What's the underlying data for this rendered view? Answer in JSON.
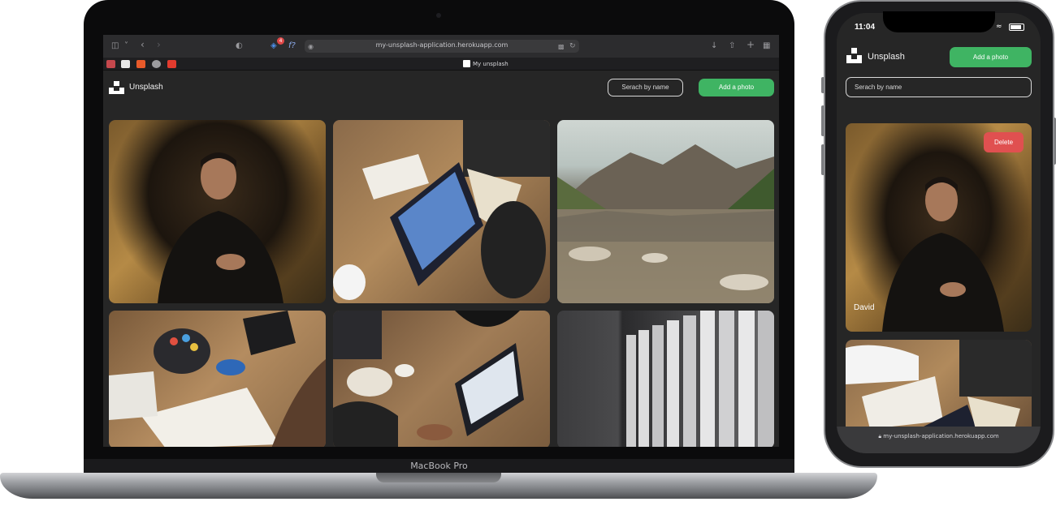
{
  "browser": {
    "url": "my-unsplash-application.herokuapp.com",
    "tab_title": "My unsplash",
    "extension_badge": "4"
  },
  "device": {
    "label": "MacBook Pro"
  },
  "app": {
    "brand": "Unsplash",
    "search_placeholder": "Serach by name",
    "add_button": "Add a photo",
    "accent": "#3fb463",
    "delete_color": "#e05050"
  },
  "phone": {
    "time": "11:04",
    "url": "my-unsplash-application.herokuapp.com",
    "delete_button": "Delete",
    "photo_caption": "David"
  }
}
